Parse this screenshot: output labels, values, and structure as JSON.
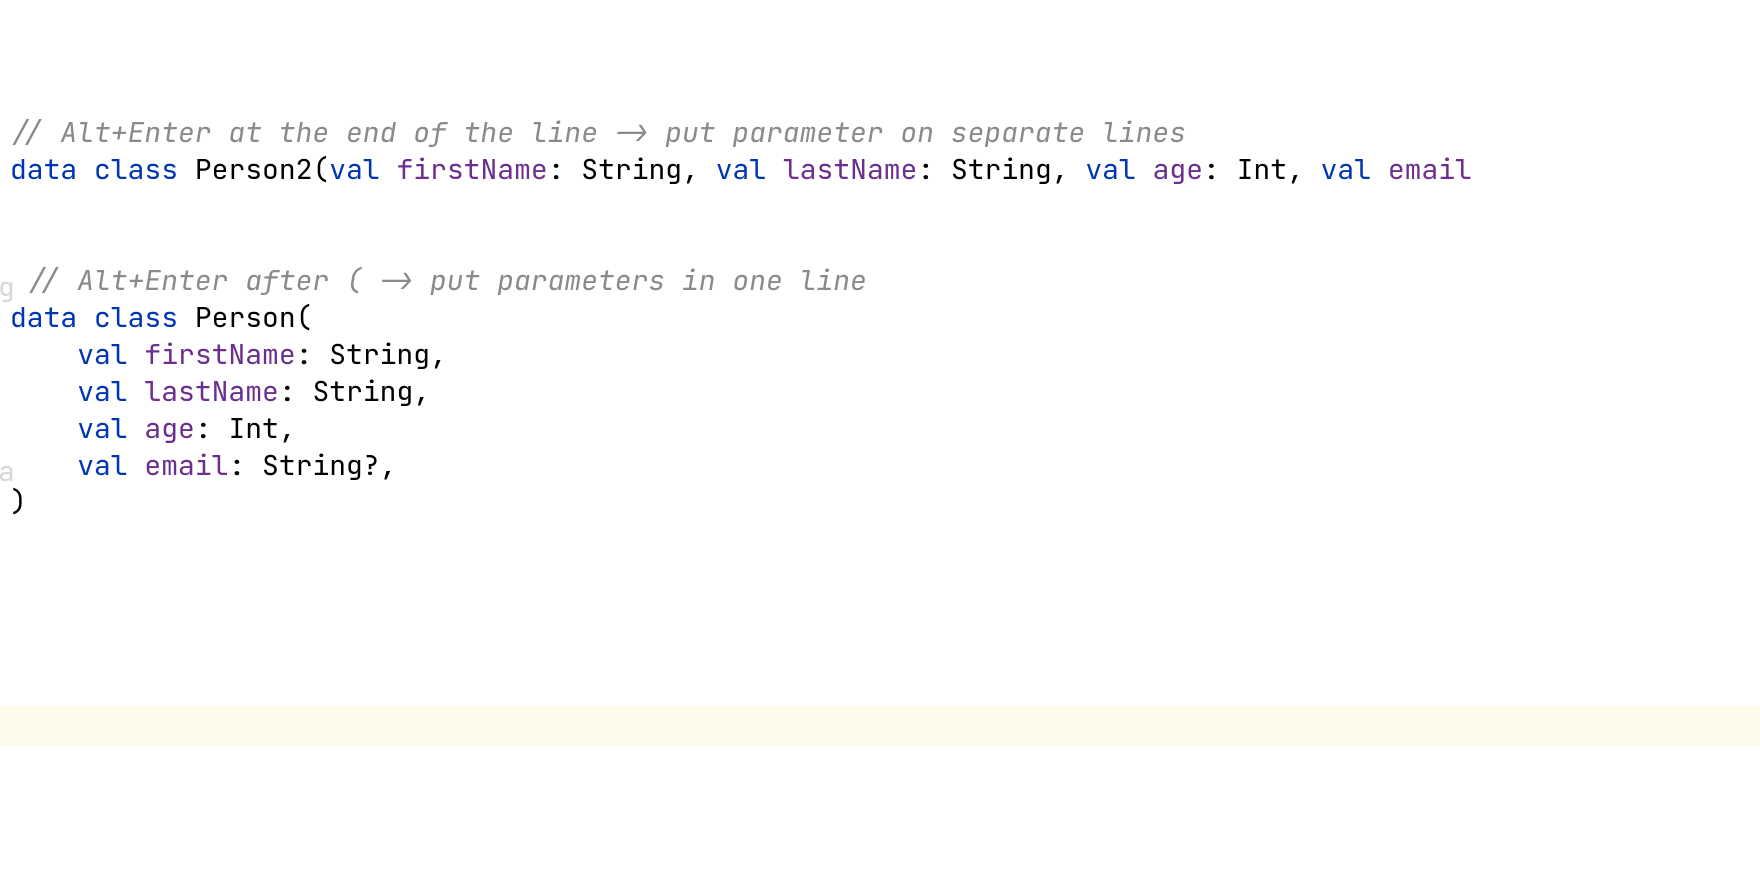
{
  "lines": {
    "comment1": "// Alt+Enter at the end of the line -> put parameter on separate lines",
    "comment2": " // Alt+Enter after ( -> put parameters in one line",
    "kw_data1": "data",
    "kw_class1": "class",
    "class1": "Person2",
    "kw_data2": "data",
    "kw_class2": "class",
    "class2": "Person",
    "kw_val": "val",
    "p_firstName": "firstName",
    "p_lastName": "lastName",
    "p_age": "age",
    "p_email": "email",
    "t_string": "String",
    "t_int": "Int",
    "sep_colon_space": ": ",
    "sep_comma_space": ", ",
    "sep_comma": ",",
    "sep_q_comma": "?,",
    "open_paren": "(",
    "close_paren": ")",
    "space": " ",
    "indent": "    ",
    "blank": "",
    "gutter_a": "g",
    "gutter_b": "a"
  }
}
